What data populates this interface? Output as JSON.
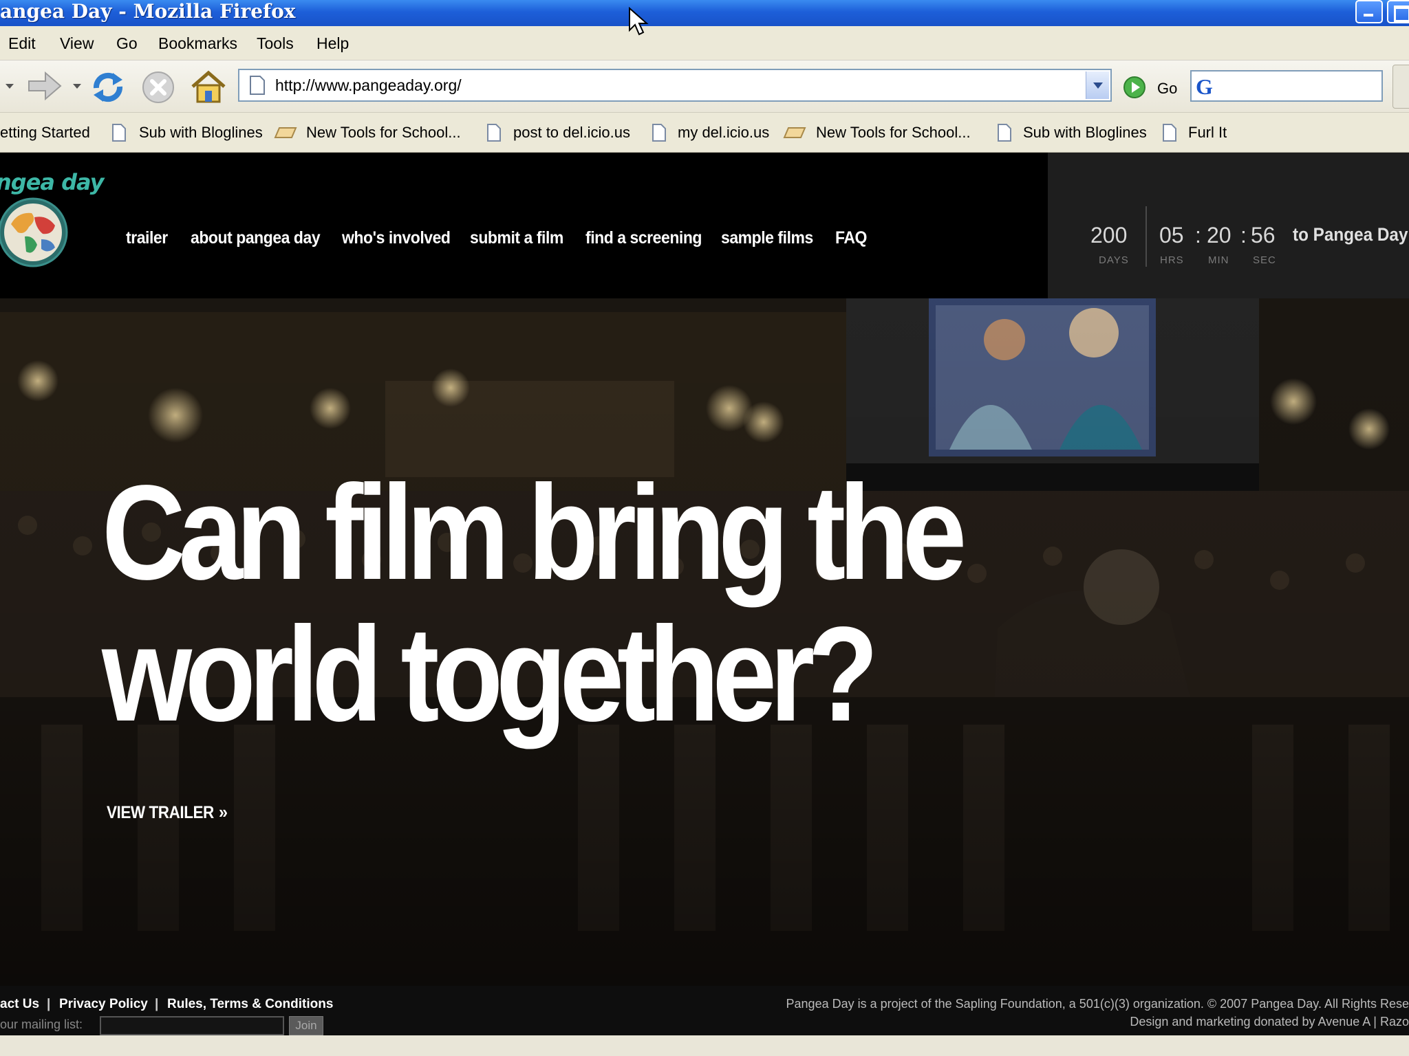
{
  "window": {
    "title": "angea Day - Mozilla Firefox"
  },
  "menubar": {
    "items": [
      "Edit",
      "View",
      "Go",
      "Bookmarks",
      "Tools",
      "Help"
    ]
  },
  "navbar": {
    "url": "http://www.pangeaday.org/",
    "go_label": "Go",
    "search_glyph": "G"
  },
  "bookmarks": {
    "items": [
      "etting Started",
      "Sub with Bloglines",
      "New Tools for School...",
      "post to del.icio.us",
      "my del.icio.us",
      "New Tools for School...",
      "Sub with Bloglines",
      "Furl It"
    ]
  },
  "site": {
    "logo_text": "ngea day",
    "nav": [
      "trailer",
      "about pangea day",
      "who's involved",
      "submit a film",
      "find a screening",
      "sample films",
      "FAQ"
    ],
    "countdown": {
      "days": "200",
      "days_label": "DAYS",
      "hrs": "05",
      "hrs_label": "HRS",
      "min": "20",
      "min_label": "MIN",
      "sec": "56",
      "sec_label": "SEC",
      "separator": ":",
      "suffix": "to Pangea Day"
    },
    "hero": {
      "headline_line1": "Can film bring the",
      "headline_line2": "world together?",
      "cta": "VIEW TRAILER",
      "cta_chevron": "»"
    },
    "footer": {
      "links": [
        "act Us",
        "Privacy Policy",
        "Rules, Terms & Conditions"
      ],
      "separator": "|",
      "mailing_label": "our mailing list:",
      "join_label": "Join",
      "copyright": "Pangea Day is a project of the Sapling Foundation, a 501(c)(3) organization. © 2007 Pangea Day. All Rights Rese",
      "credits": "Design and marketing donated by Avenue A | Razo"
    }
  },
  "colors": {
    "titlebar": "#1d5fd9",
    "chrome": "#ece9d8",
    "site_bg": "#000000",
    "logo_teal": "#3db7a6"
  }
}
